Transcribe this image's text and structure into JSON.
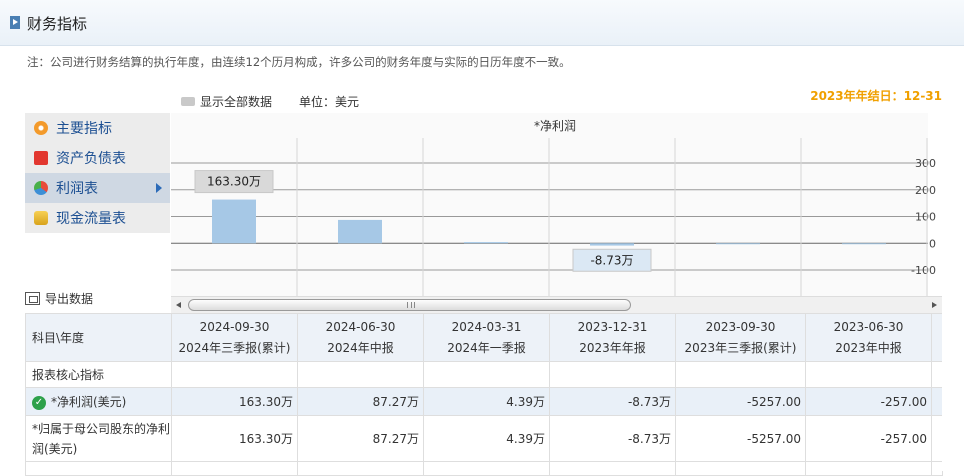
{
  "section_title": "财务指标",
  "note": "注：公司进行财务结算的执行年度，由连续12个历月构成，许多公司的财务年度与实际的日历年度不一致。",
  "legend_label": "显示全部数据",
  "unit_label": "单位：美元",
  "year_end": "2023年年结日：12-31",
  "menu": [
    {
      "label": "主要指标",
      "icon": "main-indicator-icon"
    },
    {
      "label": "资产负债表",
      "icon": "balance-sheet-icon"
    },
    {
      "label": "利润表",
      "icon": "income-statement-icon",
      "active": true
    },
    {
      "label": "现金流量表",
      "icon": "cash-flow-icon"
    }
  ],
  "export_label": "导出数据",
  "chart_data": {
    "type": "bar",
    "title": "*净利润",
    "unit": "万",
    "categories": [
      "2024-09-30",
      "2024-06-30",
      "2024-03-31",
      "2023-12-31",
      "2023-09-30",
      "2023-06-30"
    ],
    "values": [
      163.3,
      87.27,
      4.39,
      -8.73,
      -0.5257,
      -0.0257
    ],
    "yticks": [
      300,
      200,
      100,
      0,
      -100
    ],
    "ylim": [
      -100,
      300
    ],
    "callouts": [
      {
        "index": 0,
        "label": "163.30万"
      },
      {
        "index": 3,
        "label": "-8.73万"
      }
    ],
    "bar_color": "#a6c8e6",
    "grid": true
  },
  "table": {
    "header_label": "科目\\年度",
    "periods": [
      {
        "date": "2024-09-30",
        "type": "2024年三季报(累计)"
      },
      {
        "date": "2024-06-30",
        "type": "2024年中报"
      },
      {
        "date": "2024-03-31",
        "type": "2024年一季报"
      },
      {
        "date": "2023-12-31",
        "type": "2023年年报"
      },
      {
        "date": "2023-09-30",
        "type": "2023年三季报(累计)"
      },
      {
        "date": "2023-06-30",
        "type": "2023年中报"
      }
    ],
    "section_label": "报表核心指标",
    "rows": [
      {
        "label": "*净利润(美元)",
        "values": [
          "163.30万",
          "87.27万",
          "4.39万",
          "-8.73万",
          "-5257.00",
          "-257.00"
        ]
      },
      {
        "label": "*归属于母公司股东的净利润(美元)",
        "values": [
          "163.30万",
          "87.27万",
          "4.39万",
          "-8.73万",
          "-5257.00",
          "-257.00"
        ]
      }
    ]
  }
}
